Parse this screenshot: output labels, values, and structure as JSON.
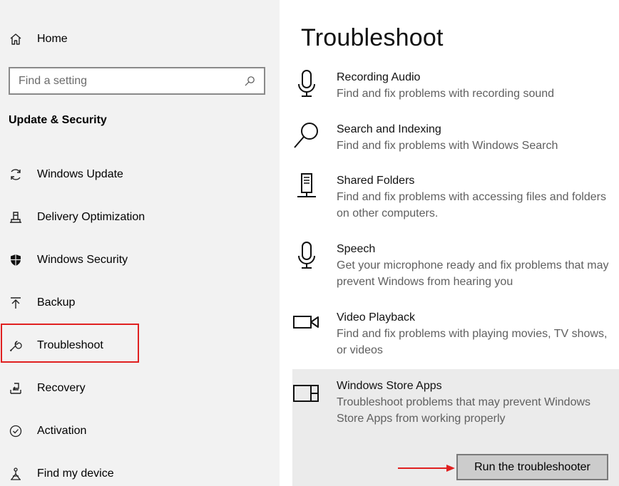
{
  "sidebar": {
    "home_label": "Home",
    "search_placeholder": "Find a setting",
    "section_title": "Update & Security",
    "items": [
      {
        "label": "Windows Update",
        "icon": "sync-icon"
      },
      {
        "label": "Delivery Optimization",
        "icon": "delivery-optimization-icon"
      },
      {
        "label": "Windows Security",
        "icon": "shield-icon"
      },
      {
        "label": "Backup",
        "icon": "backup-arrow-icon"
      },
      {
        "label": "Troubleshoot",
        "icon": "wrench-icon"
      },
      {
        "label": "Recovery",
        "icon": "recovery-icon"
      },
      {
        "label": "Activation",
        "icon": "check-circle-icon"
      },
      {
        "label": "Find my device",
        "icon": "find-device-icon"
      }
    ],
    "highlighted_item": "Troubleshoot",
    "highlight_color": "#e02020"
  },
  "main": {
    "title": "Troubleshoot",
    "troubleshooters": [
      {
        "name": "Recording Audio",
        "description": "Find and fix problems with recording sound",
        "icon": "microphone-icon"
      },
      {
        "name": "Search and Indexing",
        "description": "Find and fix problems with Windows Search",
        "icon": "search-icon"
      },
      {
        "name": "Shared Folders",
        "description": "Find and fix problems with accessing files and folders on other computers.",
        "icon": "shared-folders-icon"
      },
      {
        "name": "Speech",
        "description": "Get your microphone ready and fix problems that may prevent Windows from hearing you",
        "icon": "microphone-icon"
      },
      {
        "name": "Video Playback",
        "description": "Find and fix problems with playing movies, TV shows, or videos",
        "icon": "video-camera-icon"
      },
      {
        "name": "Windows Store Apps",
        "description": "Troubleshoot problems that may prevent Windows Store Apps from working properly",
        "icon": "store-apps-icon"
      }
    ],
    "selected_troubleshooter": "Windows Store Apps",
    "run_button_label": "Run the troubleshooter",
    "annotation_arrow_color": "#e02020"
  }
}
